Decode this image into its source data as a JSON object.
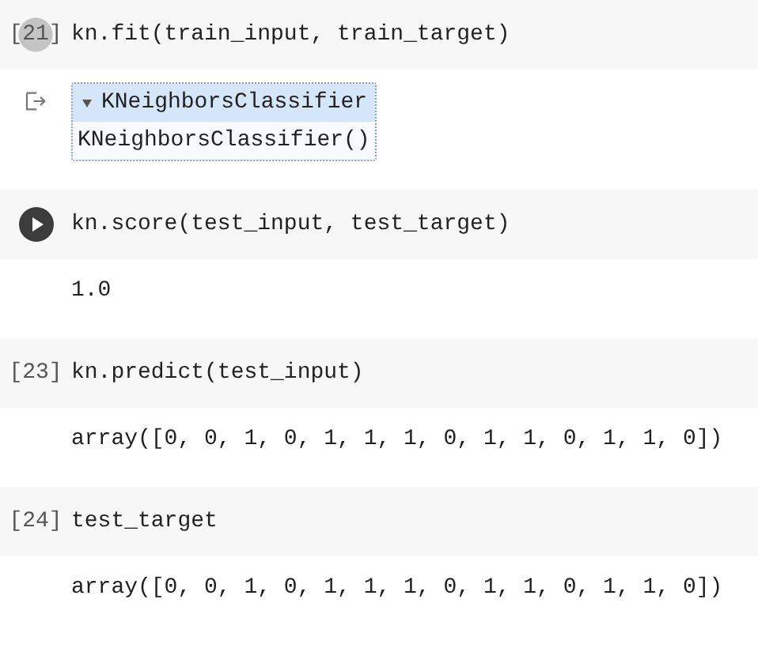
{
  "cells": [
    {
      "kind": "count",
      "prompt": "[21]",
      "hovered": true,
      "code": "kn.fit(train_input, train_target)",
      "output": {
        "kind": "estimator",
        "title": "KNeighborsClassifier",
        "repr": "KNeighborsClassifier()",
        "expanded": true
      }
    },
    {
      "kind": "run",
      "code": "kn.score(test_input, test_target)",
      "output": {
        "kind": "text",
        "text": "1.0"
      }
    },
    {
      "kind": "count",
      "prompt": "[23]",
      "hovered": false,
      "code": "kn.predict(test_input)",
      "output": {
        "kind": "text",
        "text": "array([0, 0, 1, 0, 1, 1, 1, 0, 1, 1, 0, 1, 1, 0])"
      }
    },
    {
      "kind": "count",
      "prompt": "[24]",
      "hovered": false,
      "code": "test_target",
      "output": {
        "kind": "text",
        "text": "array([0, 0, 1, 0, 1, 1, 1, 0, 1, 1, 0, 1, 1, 0])"
      }
    }
  ]
}
